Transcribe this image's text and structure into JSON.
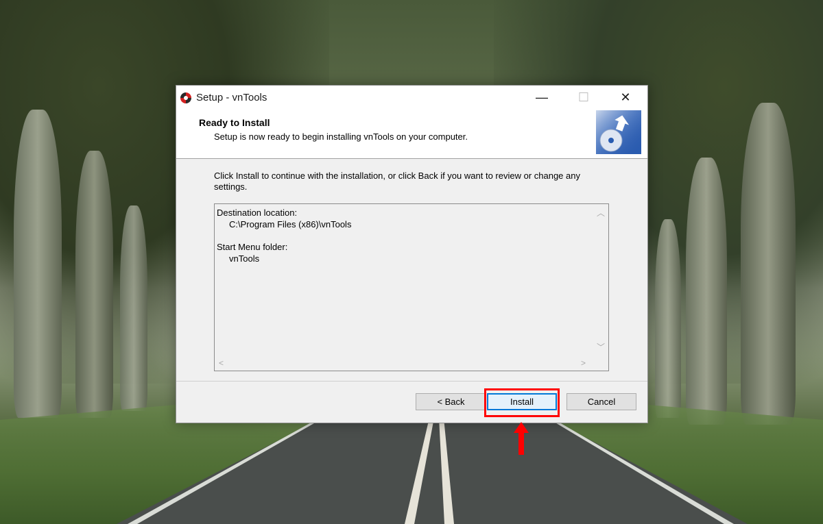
{
  "window": {
    "title": "Setup - vnTools",
    "minimize_glyph": "—",
    "maximize_glyph": "☐",
    "close_glyph": "✕"
  },
  "header": {
    "title": "Ready to Install",
    "subtitle": "Setup is now ready to begin installing vnTools on your computer."
  },
  "body": {
    "intro": "Click Install to continue with the installation, or click Back if you want to review or change any settings.",
    "memo": {
      "destination_label": "Destination location:",
      "destination_value": "C:\\Program Files (x86)\\vnTools",
      "start_menu_label": "Start Menu folder:",
      "start_menu_value": "vnTools"
    }
  },
  "buttons": {
    "back": "< Back",
    "install": "Install",
    "cancel": "Cancel"
  },
  "colors": {
    "accent": "#0078d7",
    "annotation": "#ff0000"
  },
  "icons": {
    "app": "vntools-logo-icon",
    "header": "setup-disc-icon",
    "annotation_arrow": "red-up-arrow"
  }
}
